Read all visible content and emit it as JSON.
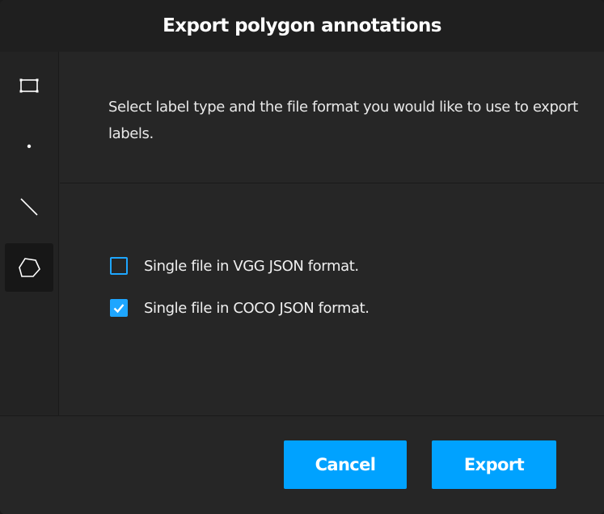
{
  "dialog": {
    "title": "Export polygon annotations",
    "description": "Select label type and the file format you would like to use to export labels."
  },
  "sidebar": {
    "tools": [
      {
        "name": "rectangle",
        "icon": "rectangle-icon",
        "active": false
      },
      {
        "name": "point",
        "icon": "point-icon",
        "active": false
      },
      {
        "name": "line",
        "icon": "line-icon",
        "active": false
      },
      {
        "name": "polygon",
        "icon": "polygon-icon",
        "active": true
      }
    ]
  },
  "options": [
    {
      "label": "Single file in VGG JSON format.",
      "checked": false
    },
    {
      "label": "Single file in COCO JSON format.",
      "checked": true
    }
  ],
  "buttons": {
    "cancel": "Cancel",
    "export": "Export"
  },
  "colors": {
    "accent": "#00a2ff",
    "background": "#262626",
    "header": "#1f1f1f",
    "active_tool": "#171717"
  }
}
